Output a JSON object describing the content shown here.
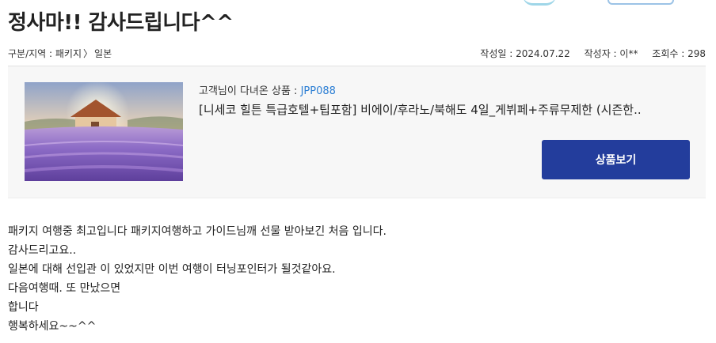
{
  "post": {
    "title": "정사마!! 감사드립니다^^",
    "breadcrumb": {
      "prefix": "구분/지역 : ",
      "category": "패키지",
      "separator": "〉",
      "region": "일본"
    },
    "meta": {
      "date_label": "작성일 : ",
      "date": "2024.07.22",
      "author_label": "작성자 : ",
      "author": "이**",
      "views_label": "조회수 : ",
      "views": "298"
    }
  },
  "product": {
    "label": "고객님이 다녀온 상품 : ",
    "code": "JPP088",
    "name": "[니세코 힐튼 특급호텔+팁포함] 비에이/후라노/북해도 4일_게뷔페+주류무제한 (시즌한..",
    "button_label": "상품보기",
    "image_icon": "lavender-field-photo"
  },
  "content": {
    "lines": [
      "패키지 여행중 최고입니다 패키지여행하고 가이드님깨 선물 받아보긴 처음 입니다.",
      "감사드리고요..",
      "일본에 대해 선입관 이 있었지만 이번 여행이 터닝포인터가 될것같아요.",
      "다음여행때. 또 만났으면",
      "합니다",
      "행복하세요~~^^"
    ]
  },
  "colors": {
    "accent_button": "#233d9c",
    "product_code": "#2d7fd4",
    "panel_bg": "#f7f7f7"
  }
}
